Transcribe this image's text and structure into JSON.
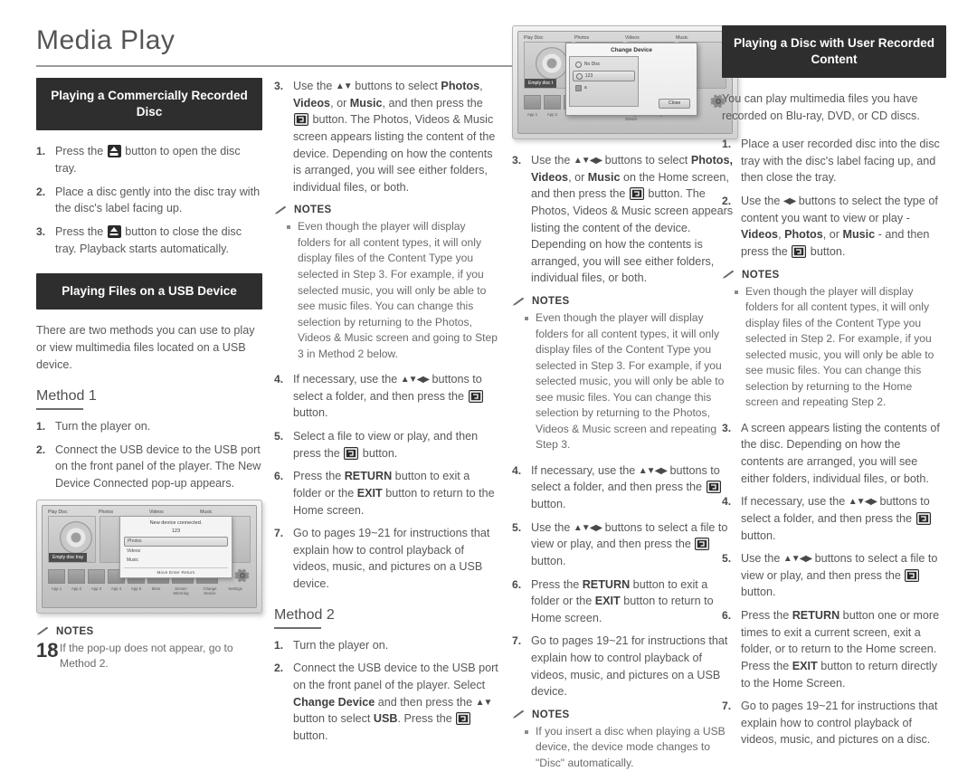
{
  "document": {
    "title": "Media Play",
    "page_number": "18"
  },
  "column1": {
    "section_title": "Playing a Commercially Recorded Disc",
    "steps": [
      {
        "num": "1.",
        "parts": [
          "Press the ",
          "[EJECT]",
          " button to open the disc tray."
        ]
      },
      {
        "num": "2.",
        "parts": [
          "Place a disc gently into the disc tray with the disc's label facing up."
        ]
      },
      {
        "num": "3.",
        "parts": [
          "Press the ",
          "[EJECT]",
          " button to close the disc tray. Playback starts automatically."
        ]
      }
    ],
    "section_title_2": "Playing Files on a USB Device",
    "intro": "There are two methods you can use to play or view multimedia files located on a USB device.",
    "method_label": "Method 1",
    "method_steps": [
      {
        "num": "1.",
        "text": "Turn the player on."
      },
      {
        "num": "2.",
        "text": "Connect the USB device to the USB port on the front panel of the player. The New Device Connected pop-up appears."
      }
    ],
    "notes_label": "NOTES",
    "notes": [
      "If the pop-up does not appear, go to Method 2."
    ],
    "screenshot": {
      "tabs": [
        "Play Disc",
        "Photos",
        "Videos",
        "Music"
      ],
      "tray_label": "Empty disc tray",
      "popup_title": "New device connected.",
      "popup_device": "123",
      "popup_rows": [
        "Photos",
        "Videos",
        "Music"
      ],
      "popup_footer": "Move    Enter    Return",
      "app_labels": [
        "App 1",
        "App 2",
        "App 3",
        "App 4",
        "App 5",
        "More",
        "Screen Mirroring",
        "Change Device",
        "Settings"
      ]
    }
  },
  "column2": {
    "steps": [
      {
        "num": "3.",
        "text_a": "Use the ",
        "arrows_a": "▲▼",
        "text_b": " buttons to select ",
        "kw1": "Photos",
        "text_c": ", ",
        "kw2": "Videos",
        "text_d": ", or ",
        "kw3": "Music",
        "text_e": ", and then press the ",
        "text_f": " button. The Photos, Videos & Music screen appears listing the content of the device. Depending on how the contents is arranged, you will see either folders, individual files, or both."
      }
    ],
    "notes_label": "NOTES",
    "notes": [
      "Even though the player will display folders for all content types, it will only display files of the Content Type you selected in Step 3. For example, if you selected music, you will only be able to see music files. You can change this selection by returning to the Photos, Videos & Music screen and going to Step 3 in Method 2 below."
    ],
    "steps2": [
      {
        "num": "4.",
        "text_a": "If necessary, use the ",
        "arrows": "▲▼◀▶",
        "text_b": " buttons to select a folder, and then press the ",
        "text_c": " button."
      },
      {
        "num": "5.",
        "text_a": "Select a file to view or play, and then press the ",
        "text_c": " button."
      },
      {
        "num": "6.",
        "text_a": "Press the ",
        "kw1": "RETURN",
        "text_b": " button to exit a folder or the ",
        "kw2": "EXIT",
        "text_c": " button to return to the Home screen."
      },
      {
        "num": "7.",
        "text_a": "Go to pages 19~21 for instructions that explain how to control playback of videos, music, and pictures on a USB device."
      }
    ],
    "method_label": "Method 2",
    "method_steps": [
      {
        "num": "1.",
        "text_a": "Turn the player on."
      },
      {
        "num": "2.",
        "text_a": "Connect the USB device to the USB port on the front panel of the player. Select ",
        "kw1": "Change Device",
        "text_b": " and then press the ",
        "arrows": "▲▼",
        "text_c": " button to select ",
        "kw2": "USB",
        "text_d": ". Press the ",
        "text_e": " button."
      }
    ]
  },
  "column3": {
    "screenshot": {
      "tabs": [
        "Play Disc",
        "Photos",
        "Videos",
        "Music"
      ],
      "tray_label": "Empty disc t",
      "dialog_title": "Change Device",
      "dialog_rows": [
        "No Disc",
        "123",
        "a"
      ],
      "close_label": "Close",
      "app_labels": [
        "App 1",
        "App 2",
        "Change Device",
        "Settings"
      ]
    },
    "steps": [
      {
        "num": "3.",
        "text_a": "Use the ",
        "arrows": "▲▼◀▶",
        "text_b": " buttons to select ",
        "kw1": "Photos, Videos",
        "text_c": ", or ",
        "kw2": "Music",
        "text_d": " on the Home screen, and then press the ",
        "text_e": " button. The Photos, Videos & Music screen appears listing the content of the device. Depending on how the contents is arranged, you will see either folders, individual files, or both."
      }
    ],
    "notes_label": "NOTES",
    "notes": [
      "Even though the player will display folders for all content types, it will only display files of the Content Type you selected in Step 3. For example, if you selected music, you will only be able to see music files. You can change this selection by returning to the Photos, Videos & Music screen and repeating Step 3."
    ],
    "steps2": [
      {
        "num": "4.",
        "text_a": "If necessary, use the ",
        "arrows": "▲▼◀▶",
        "text_b": " buttons to select a folder, and then press the ",
        "text_c": " button."
      },
      {
        "num": "5.",
        "text_a": "Use the ",
        "arrows": "▲▼◀▶",
        "text_b": " buttons to select a file to view or play, and then press the ",
        "text_c": " button."
      },
      {
        "num": "6.",
        "text_a": "Press the ",
        "kw1": "RETURN",
        "text_b": " button to exit a folder or the ",
        "kw2": "EXIT",
        "text_c": " button to return to Home screen."
      },
      {
        "num": "7.",
        "text_a": "Go to pages 19~21 for instructions that explain how to control playback of videos, music, and pictures on a USB device."
      }
    ],
    "notes_label_2": "NOTES",
    "notes2": [
      "If you insert a disc when playing a USB device, the device mode changes to \"Disc\" automatically."
    ]
  },
  "column4": {
    "section_title": "Playing a Disc with User Recorded Content",
    "intro": "You can play multimedia files you have recorded on Blu-ray, DVD, or CD discs.",
    "steps": [
      {
        "num": "1.",
        "text_a": "Place a user recorded disc into the disc tray with the disc's label facing up, and then close the tray."
      },
      {
        "num": "2.",
        "text_a": "Use the ",
        "arrows": "◀▶",
        "text_b": " buttons to select the type of content you want to view or play - ",
        "kw1": "Videos",
        "text_c": ", ",
        "kw2": "Photos",
        "text_d": ", or ",
        "kw3": "Music",
        "text_e": " - and then press the ",
        "text_f": " button."
      }
    ],
    "notes_label": "NOTES",
    "notes": [
      "Even though the player will display folders for all content types, it will only display files of the Content Type you selected in Step 2. For example, if you selected music, you will only be able to see music files. You can change this selection by returning to the Home screen and repeating Step 2."
    ],
    "steps2": [
      {
        "num": "3.",
        "text_a": "A screen appears listing the contents of the disc. Depending on how the contents are arranged, you will see either folders, individual files, or both."
      },
      {
        "num": "4.",
        "text_a": "If necessary, use the ",
        "arrows": "▲▼◀▶",
        "text_b": " buttons to select a folder, and then press the ",
        "text_c": " button."
      },
      {
        "num": "5.",
        "text_a": "Use the ",
        "arrows": "▲▼◀▶",
        "text_b": " buttons to select a file to view or play, and then press the ",
        "text_c": " button."
      },
      {
        "num": "6.",
        "text_a": "Press the ",
        "kw1": "RETURN",
        "text_b": " button one or more times to exit a current screen, exit a folder, or to return to the Home screen. Press the ",
        "kw2": "EXIT",
        "text_c": " button to return directly to the Home Screen."
      },
      {
        "num": "7.",
        "text_a": "Go to pages 19~21 for instructions that explain how to control playback of videos, music, and pictures on a disc."
      }
    ]
  }
}
